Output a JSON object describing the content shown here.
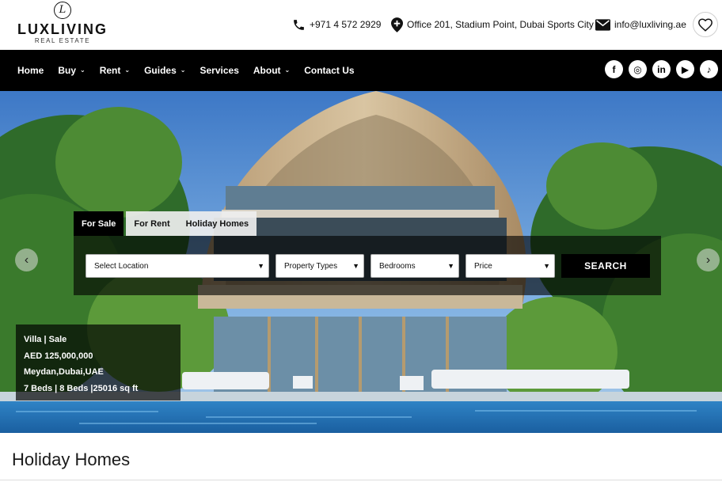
{
  "brand": {
    "mark": "L",
    "name": "LUXLIVING",
    "sub": "REAL ESTATE"
  },
  "contact": {
    "phone": "+971 4 572 2929",
    "office": "Office 201, Stadium Point, Dubai Sports City",
    "email": "info@luxliving.ae"
  },
  "nav": {
    "items": [
      {
        "label": "Home"
      },
      {
        "label": "Buy",
        "chevron": "ˇ"
      },
      {
        "label": "Rent",
        "chevron": "ˇ"
      },
      {
        "label": "Guides",
        "chevron": "ˇ"
      },
      {
        "label": "Services"
      },
      {
        "label": "About",
        "chevron": "ˇ"
      },
      {
        "label": "Contact Us"
      }
    ],
    "socials": [
      {
        "icon": "facebook-icon",
        "glyph": "f"
      },
      {
        "icon": "instagram-icon",
        "glyph": "◎"
      },
      {
        "icon": "linkedin-icon",
        "glyph": "in"
      },
      {
        "icon": "youtube-icon",
        "glyph": "▶"
      },
      {
        "icon": "tiktok-icon",
        "glyph": "♪"
      }
    ]
  },
  "search": {
    "tabs": [
      "For Sale",
      "For Rent",
      "Holiday Homes"
    ],
    "location": "Select Location",
    "property_type": "Property Types",
    "bedrooms": "Bedrooms",
    "price": "Price",
    "button": "SEARCH"
  },
  "slider": {
    "prev": "‹",
    "next": "›"
  },
  "listing": {
    "type": "Villa | Sale",
    "price": "AED 125,000,000",
    "location": "Meydan,Dubai,UAE",
    "details": "7 Beds | 8 Beds |25016 sq ft"
  },
  "section": {
    "title": "Holiday Homes"
  },
  "colors": {
    "nav_bg": "#000000",
    "accent": "#000000"
  }
}
